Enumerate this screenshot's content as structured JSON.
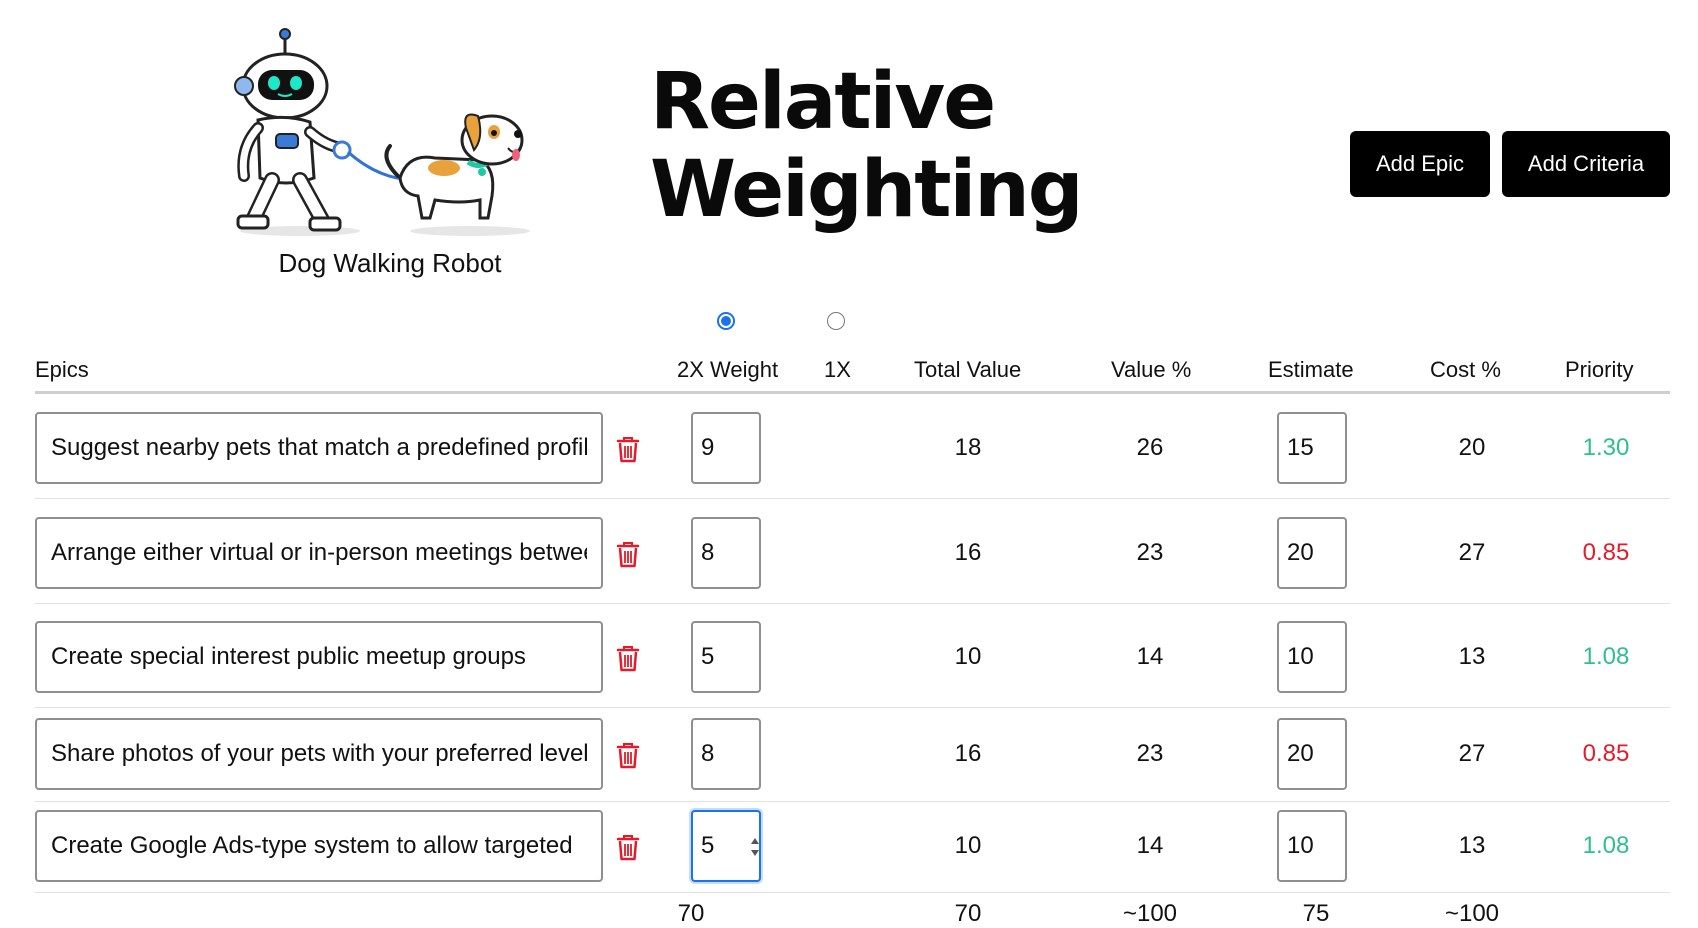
{
  "header": {
    "logo_caption": "Dog Walking Robot",
    "title_line1": "Relative",
    "title_line2": "Weighting",
    "add_epic_label": "Add Epic",
    "add_criteria_label": "Add Criteria"
  },
  "weight_mode": {
    "selected": "2X"
  },
  "columns": {
    "epics": "Epics",
    "weight": "2X Weight",
    "weight_alt": "1X",
    "total_value": "Total Value",
    "value_pct": "Value %",
    "estimate": "Estimate",
    "cost_pct": "Cost %",
    "priority": "Priority"
  },
  "rows": [
    {
      "epic": "Suggest nearby pets that match a predefined profile",
      "weight": "9",
      "total_value": "18",
      "value_pct": "26",
      "estimate": "15",
      "cost_pct": "20",
      "priority": "1.30",
      "priority_status": "good"
    },
    {
      "epic": "Arrange either virtual or in-person meetings between",
      "weight": "8",
      "total_value": "16",
      "value_pct": "23",
      "estimate": "20",
      "cost_pct": "27",
      "priority": "0.85",
      "priority_status": "bad"
    },
    {
      "epic": "Create special interest public meetup groups",
      "weight": "5",
      "total_value": "10",
      "value_pct": "14",
      "estimate": "10",
      "cost_pct": "13",
      "priority": "1.08",
      "priority_status": "good"
    },
    {
      "epic": "Share photos of your pets with your preferred level",
      "weight": "8",
      "total_value": "16",
      "value_pct": "23",
      "estimate": "20",
      "cost_pct": "27",
      "priority": "0.85",
      "priority_status": "bad"
    },
    {
      "epic": "Create Google Ads-type system to allow targeted",
      "weight": "5",
      "total_value": "10",
      "value_pct": "14",
      "estimate": "10",
      "cost_pct": "13",
      "priority": "1.08",
      "priority_status": "good"
    }
  ],
  "totals": {
    "weight": "70",
    "total_value": "70",
    "value_pct": "~100",
    "estimate": "75",
    "cost_pct": "~100"
  },
  "colors": {
    "priority_good": "#2fbf8f",
    "priority_bad": "#e31b2a",
    "focus_blue": "#1a73e8",
    "trash_red": "#e31b2a"
  }
}
